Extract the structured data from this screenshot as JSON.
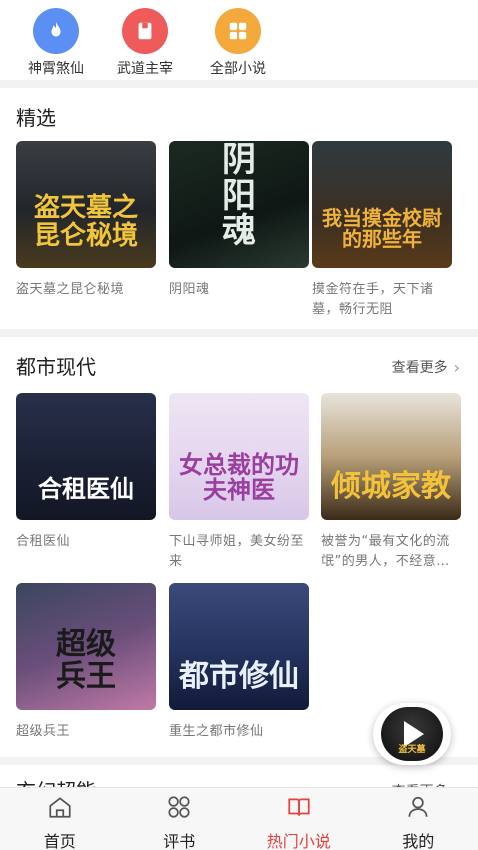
{
  "categories": [
    {
      "label": "神霄煞仙",
      "icon": "flame-icon",
      "color": "#5b8ff4"
    },
    {
      "label": "武道主宰",
      "icon": "book-icon",
      "color": "#ef5a5a"
    },
    {
      "label": "全部小说",
      "icon": "grid-icon",
      "color": "#f3a93b"
    }
  ],
  "featured": {
    "title": "精选",
    "books": [
      {
        "cover_text": "盗天墓之昆仑秘境",
        "desc": "盗天墓之昆仑秘境"
      },
      {
        "cover_text": "阴阳魂",
        "desc": "阴阳魂"
      },
      {
        "cover_text": "我当摸金校尉的那些年",
        "desc": "摸金符在手，天下诸墓，畅行无阻"
      }
    ]
  },
  "urban": {
    "title": "都市现代",
    "more_label": "查看更多",
    "books": [
      {
        "cover_text": "合租医仙",
        "desc": "合租医仙"
      },
      {
        "cover_text": "女总裁的功夫神医",
        "desc": "下山寻师姐，美女纷至来"
      },
      {
        "cover_text": "倾城家教",
        "desc": "被誉为“最有文化的流氓”的男人，不经意…"
      },
      {
        "cover_text": "超级兵王",
        "desc": "超级兵王"
      },
      {
        "cover_text": "都市修仙",
        "desc": "重生之都市修仙"
      }
    ]
  },
  "fantasy": {
    "title": "玄幻超能",
    "more_label": "查看更多"
  },
  "player": {
    "cover_text": "盗天墓"
  },
  "nav": [
    {
      "label": "首页",
      "icon": "home-icon"
    },
    {
      "label": "评书",
      "icon": "grid-icon"
    },
    {
      "label": "热门小说",
      "icon": "open-book-icon",
      "active": true
    },
    {
      "label": "我的",
      "icon": "user-icon"
    }
  ],
  "colors": {
    "accent": "#e8413b",
    "separator": "#f2f2f2"
  }
}
